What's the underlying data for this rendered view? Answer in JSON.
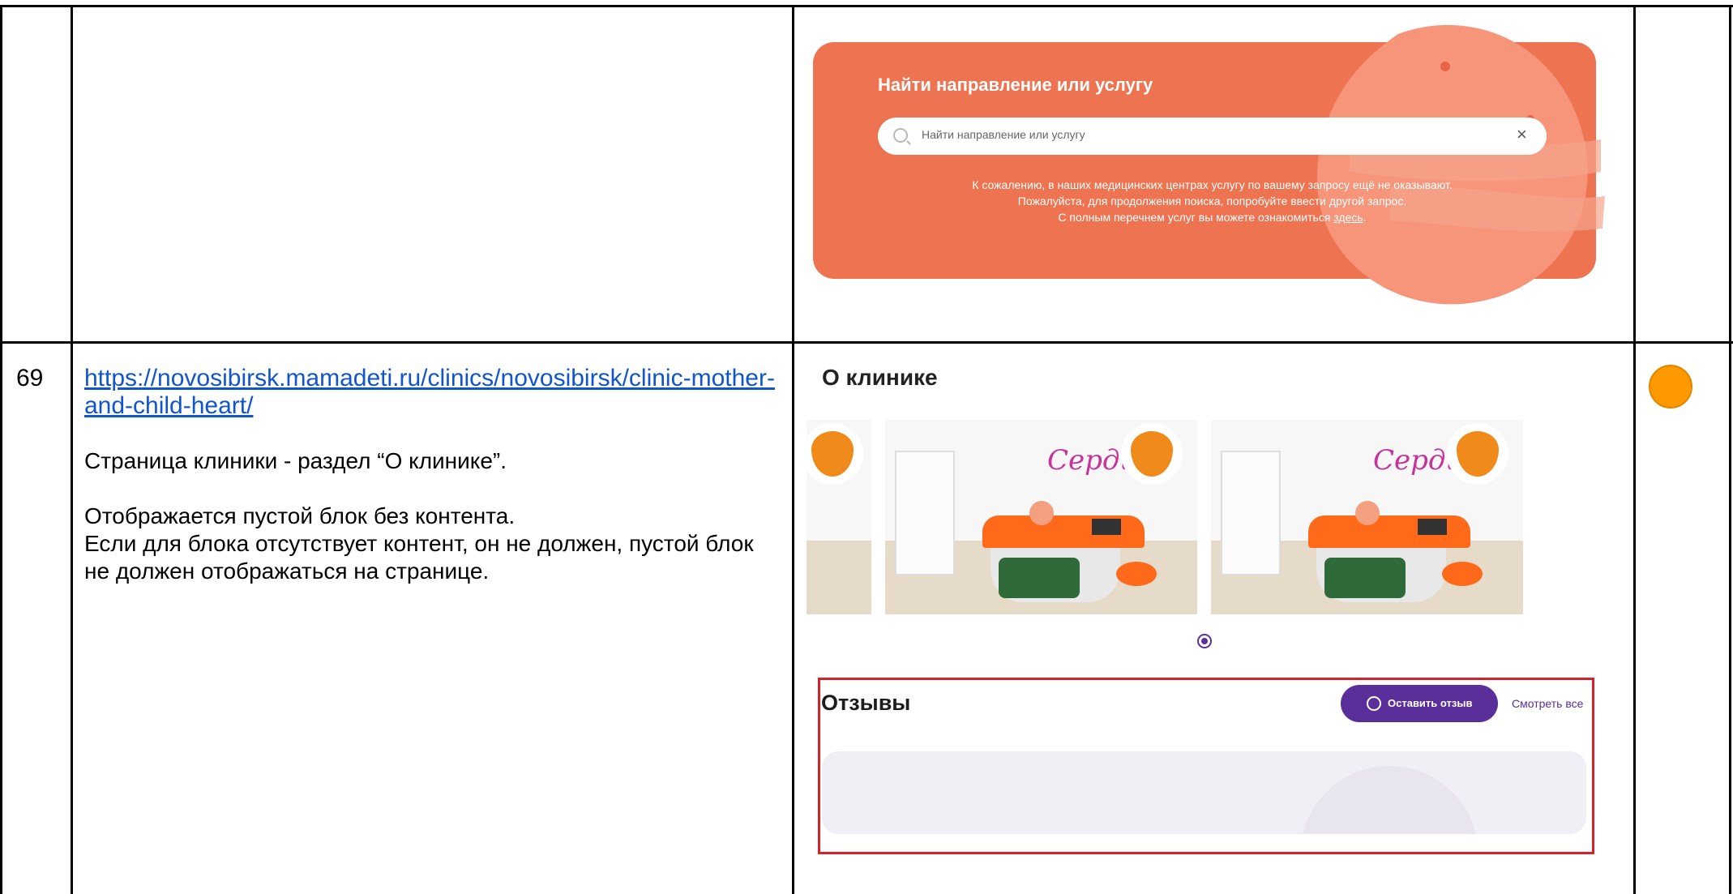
{
  "row": {
    "number": "69",
    "url": "https://novosibirsk.mamadeti.ru/clinics/novosibirsk/clinic-mother-and-child-heart/",
    "description": [
      "Страница клиники - раздел “О клинике”.",
      "Отображается пустой блок без контента.",
      "Если для блока отсутствует контент, он не должен, пустой блок не должен отображаться на странице."
    ],
    "status_color": "#ff9900"
  },
  "search_banner": {
    "title": "Найти направление или услугу",
    "placeholder": "Найти направление или услугу",
    "clear_icon": "×",
    "message_line1": "К сожалению, в наших медицинских центрах услугу по вашему запросу ещё не оказывают.",
    "message_line2": "Пожалуйста, для продолжения поиска, попробуйте ввести другой запрос.",
    "message_line3_prefix": "С полным перечнем услуг вы можете ознакомиться ",
    "message_link": "здесь",
    "message_line3_suffix": ".",
    "background_color": "#ee7350"
  },
  "clinic": {
    "about_title": "О клинике",
    "photo_logo": "Сердце",
    "reviews_title": "Отзывы",
    "leave_review_label": "Оставить отзыв",
    "see_all_label": "Смотреть все",
    "accent_color": "#5b2f9a",
    "highlight_color": "#d6202a"
  }
}
